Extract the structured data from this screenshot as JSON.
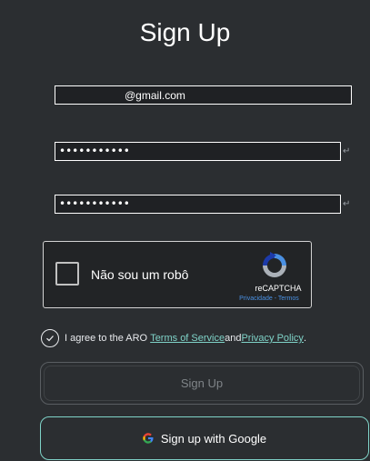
{
  "header": {
    "title": "Sign Up"
  },
  "form": {
    "email_value": "@gmail.com",
    "password_value": "•••••••••••",
    "confirm_password_value": "•••••••••••",
    "enter_glyph": "↵"
  },
  "recaptcha": {
    "label": "Não sou um robô",
    "brand": "reCAPTCHA",
    "privacy": "Privacidade",
    "separator": " - ",
    "terms": "Termos"
  },
  "agreement": {
    "prefix": "I agree to the ARO ",
    "tos_link": "Terms of Service",
    "middle": " and ",
    "privacy_link": "Privacy Policy",
    "suffix": "."
  },
  "buttons": {
    "signup_label": "Sign Up",
    "google_label": "Sign up with Google"
  },
  "colors": {
    "background": "#2b2e31",
    "accent": "#7fd3c8",
    "link_blue": "#4a90e2"
  }
}
